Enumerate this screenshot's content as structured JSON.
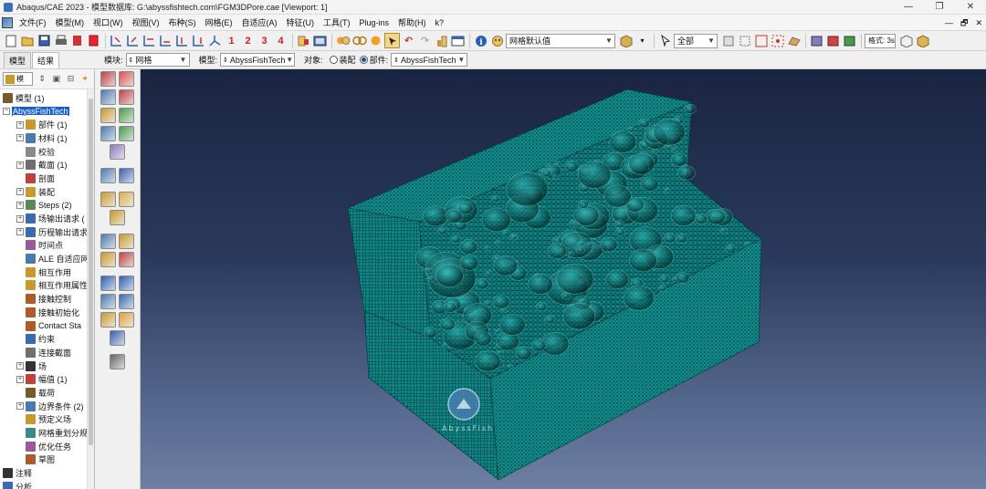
{
  "window": {
    "title": "Abaqus/CAE 2023 - 模型数据库: G:\\abyssfishtech.com\\FGM3DPore.cae [Viewport: 1]",
    "controls": [
      "—",
      "❐",
      "✕"
    ]
  },
  "menu": {
    "items": [
      "文件(F)",
      "模型(M)",
      "视口(W)",
      "视图(V)",
      "布种(S)",
      "网格(E)",
      "自适应(A)",
      "特征(U)",
      "工具(T)",
      "Plug-ins",
      "帮助(H)",
      "k?"
    ],
    "mdi_controls": [
      "—",
      "🗗",
      "✕"
    ]
  },
  "toolbar": {
    "numbers": [
      "1",
      "2",
      "3",
      "4"
    ],
    "render_style": "网格默认值",
    "selection_filter": "全部",
    "display_group_label": "格式: 3s"
  },
  "context": {
    "tabs": [
      "模型",
      "结果"
    ],
    "active_tab": "结果",
    "module_label": "模块:",
    "module_value": "网格",
    "model_label": "模型:",
    "model_value": "AbyssFishTech",
    "object_label": "对象:",
    "assembly_label": "装配",
    "part_label": "部件:",
    "part_value": "AbyssFishTech"
  },
  "tree": {
    "combo": "模",
    "nodes": [
      {
        "label": "模型 (1)",
        "level": 0,
        "expand": "",
        "color": "#7a5a2a"
      },
      {
        "label": "AbyssFishTech",
        "level": 0,
        "expand": "−",
        "color": "",
        "selected": true
      },
      {
        "label": "部件 (1)",
        "level": 1,
        "expand": "+",
        "color": "#c89a2e"
      },
      {
        "label": "材料 (1)",
        "level": 1,
        "expand": "+",
        "color": "#4a7ab0"
      },
      {
        "label": "校验",
        "level": 1,
        "expand": "",
        "color": "#8a8a8a"
      },
      {
        "label": "截面 (1)",
        "level": 1,
        "expand": "+",
        "color": "#6f6f6f"
      },
      {
        "label": "剖面",
        "level": 1,
        "expand": "",
        "color": "#c04040"
      },
      {
        "label": "装配",
        "level": 1,
        "expand": "+",
        "color": "#c89a2e"
      },
      {
        "label": "Steps (2)",
        "level": 1,
        "expand": "+",
        "color": "#5a8a5a"
      },
      {
        "label": "场输出请求 (",
        "level": 1,
        "expand": "+",
        "color": "#3a6ab0"
      },
      {
        "label": "历程输出请求",
        "level": 1,
        "expand": "+",
        "color": "#3a6ab0"
      },
      {
        "label": "时间点",
        "level": 1,
        "expand": "",
        "color": "#9a5a9a"
      },
      {
        "label": "ALE 自适应网",
        "level": 1,
        "expand": "",
        "color": "#4a7ab0"
      },
      {
        "label": "相互作用",
        "level": 1,
        "expand": "",
        "color": "#c89a2e"
      },
      {
        "label": "相互作用属性",
        "level": 1,
        "expand": "",
        "color": "#c89a2e"
      },
      {
        "label": "接触控制",
        "level": 1,
        "expand": "",
        "color": "#b05a2a"
      },
      {
        "label": "接触初始化",
        "level": 1,
        "expand": "",
        "color": "#b05a2a"
      },
      {
        "label": "Contact Sta",
        "level": 1,
        "expand": "",
        "color": "#b05a2a"
      },
      {
        "label": "约束",
        "level": 1,
        "expand": "",
        "color": "#3a6ab0"
      },
      {
        "label": "连接截面",
        "level": 1,
        "expand": "",
        "color": "#6f6f6f"
      },
      {
        "label": "场",
        "level": 1,
        "expand": "+",
        "color": "#333333"
      },
      {
        "label": "幅值 (1)",
        "level": 1,
        "expand": "+",
        "color": "#c04040"
      },
      {
        "label": "载荷",
        "level": 1,
        "expand": "",
        "color": "#7a5a2a"
      },
      {
        "label": "边界条件 (2)",
        "level": 1,
        "expand": "+",
        "color": "#4a7ab0"
      },
      {
        "label": "预定义场",
        "level": 1,
        "expand": "",
        "color": "#c89a2e"
      },
      {
        "label": "网格重划分规",
        "level": 1,
        "expand": "",
        "color": "#3a8a8a"
      },
      {
        "label": "优化任务",
        "level": 1,
        "expand": "",
        "color": "#9a5a9a"
      },
      {
        "label": "草图",
        "level": 1,
        "expand": "",
        "color": "#b05a2a"
      },
      {
        "label": "注释",
        "level": 0,
        "expand": "",
        "color": "#333333"
      },
      {
        "label": "分析",
        "level": 0,
        "expand": "",
        "color": "#3a6ab0"
      }
    ]
  },
  "viewport": {
    "watermark": "AbyssFish",
    "mesh_color": "#0fa0a0",
    "background_top": "#1a2540",
    "background_bottom": "#6d7fa3"
  }
}
